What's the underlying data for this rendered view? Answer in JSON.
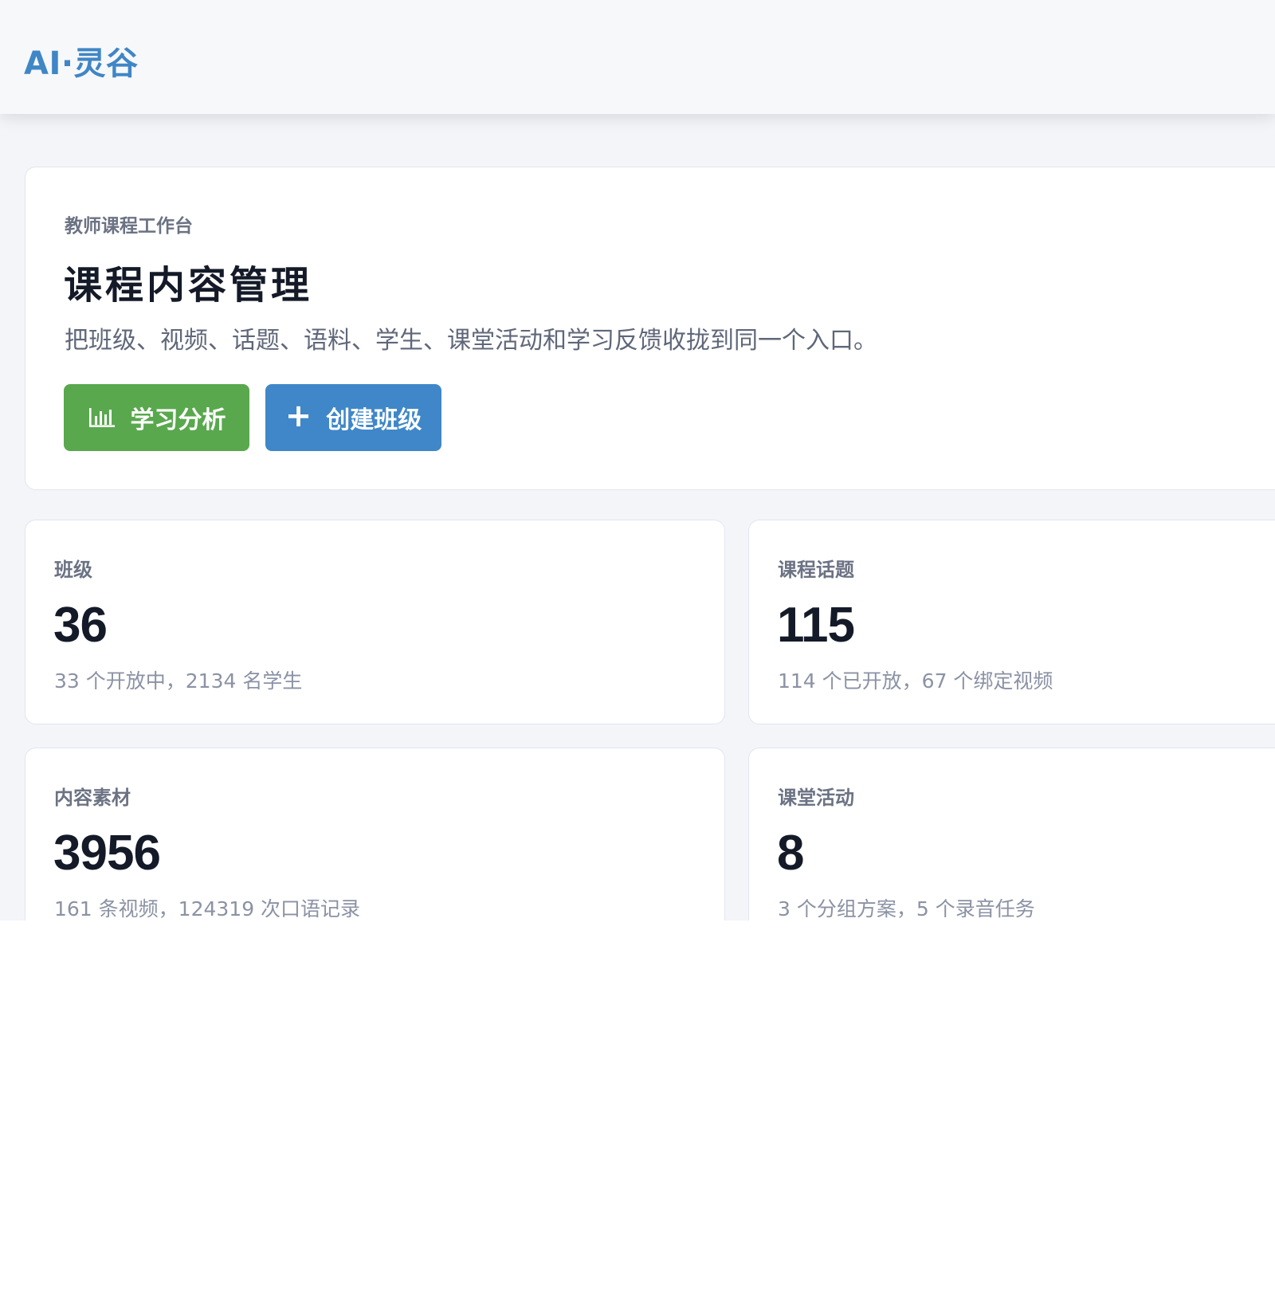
{
  "header": {
    "brand": "AI·灵谷"
  },
  "hero": {
    "kicker": "教师课程工作台",
    "title": "课程内容管理",
    "description": "把班级、视频、话题、语料、学生、课堂活动和学习反馈收拢到同一个入口。",
    "buttons": {
      "analysis": {
        "label": "学习分析",
        "icon": "bar-chart-icon",
        "color": "#59a84e"
      },
      "create": {
        "label": "创建班级",
        "icon": "plus-icon",
        "color": "#3f87c8"
      }
    }
  },
  "stats": [
    {
      "label": "班级",
      "value": "36",
      "sub": "33 个开放中，2134 名学生"
    },
    {
      "label": "课程话题",
      "value": "115",
      "sub": "114 个已开放，67 个绑定视频"
    },
    {
      "label": "内容素材",
      "value": "3956",
      "sub": "161 条视频，124319 次口语记录"
    },
    {
      "label": "课堂活动",
      "value": "8",
      "sub": "3 个分组方案，5 个录音任务"
    }
  ],
  "colors": {
    "brand": "#3f86c6",
    "page_bg": "#f3f5f9",
    "text_dark": "#141a28",
    "text_muted": "#8b92a4"
  }
}
